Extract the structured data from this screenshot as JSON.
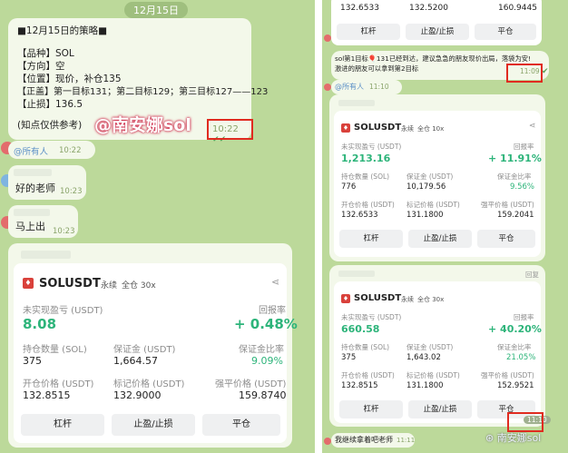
{
  "left": {
    "date_chip": "12月15日",
    "strategy": {
      "lines": [
        "■12月15日的策略■",
        "【品种】SOL",
        "【方向】空",
        "【位置】现价，补仓135",
        "【正盖】第一目标131；第二目标129；第三目标127——123",
        "【止损】136.5",
        "(知点仅供参考)"
      ],
      "time": "10:22"
    },
    "mention_all": "@所有人",
    "mention_time": "10:22",
    "msg1": {
      "text": "好的老师",
      "time": "10:23"
    },
    "msg2": {
      "text": "马上出",
      "time": "10:23"
    },
    "card": {
      "symbol": "SOLUSDT",
      "perp": "永续",
      "margin_mode": "全仓 30x",
      "pnl_label": "未实现盈亏 (USDT)",
      "roi_label": "回报率",
      "pnl": "8.08",
      "roi": "+ 0.48%",
      "row1": [
        "持仓数量 (SOL)",
        "保证金 (USDT)",
        "保证金比率"
      ],
      "row1_vals": [
        "375",
        "1,664.57",
        "9.09%"
      ],
      "row2": [
        "开仓价格 (USDT)",
        "标记价格 (USDT)",
        "强平价格 (USDT)"
      ],
      "row2_vals": [
        "132.8515",
        "132.9000",
        "159.8740"
      ],
      "buttons": [
        "杠杆",
        "止盈/止损",
        "平仓"
      ]
    },
    "watermark": "@南安娜sol"
  },
  "right": {
    "top_values": [
      "132.6533",
      "132.5200",
      "160.9445"
    ],
    "top_buttons": [
      "杠杆",
      "止盈/止损",
      "平仓"
    ],
    "msg": {
      "line1": "sol第1目标🎈131已经到达，建议急急的朋友现价出局，落袋为安!",
      "line2": "激进的朋友可以拿到第2目标",
      "time": "11:09"
    },
    "mention_all": "@所有人",
    "mention_time": "11:10",
    "card1": {
      "symbol": "SOLUSDT",
      "perp": "永续",
      "margin_mode": "全仓 10x",
      "pnl_label": "未实现盈亏 (USDT)",
      "roi_label": "回报率",
      "pnl": "1,213.16",
      "roi": "+ 11.91%",
      "row1": [
        "持仓数量 (SOL)",
        "保证金 (USDT)",
        "保证金比率"
      ],
      "row1_vals": [
        "776",
        "10,179.56",
        "9.56%"
      ],
      "row2": [
        "开仓价格 (USDT)",
        "标记价格 (USDT)",
        "强平价格 (USDT)"
      ],
      "row2_vals": [
        "132.6533",
        "131.1800",
        "159.2041"
      ],
      "buttons": [
        "杠杆",
        "止盈/止损",
        "平仓"
      ]
    },
    "card2": {
      "reply_label": "回复",
      "symbol": "SOLUSDT",
      "perp": "永续",
      "margin_mode": "全仓 30x",
      "pnl_label": "未实现盈亏 (USDT)",
      "roi_label": "回报率",
      "pnl": "660.58",
      "roi": "+ 40.20%",
      "row1": [
        "持仓数量 (SOL)",
        "保证金 (USDT)",
        "保证金比率"
      ],
      "row1_vals": [
        "375",
        "1,643.02",
        "21.05%"
      ],
      "row2": [
        "开仓价格 (USDT)",
        "标记价格 (USDT)",
        "强平价格 (USDT)"
      ],
      "row2_vals": [
        "132.8515",
        "131.1800",
        "152.9521"
      ],
      "buttons": [
        "杠杆",
        "止盈/止损",
        "平仓"
      ],
      "time": "11:10"
    },
    "bottom_msg": {
      "text": "我继续拿着吧老师",
      "time": "11:11"
    },
    "watermark": "南安娜sol"
  },
  "colors": {
    "chat_bg": "#bcd99a",
    "bubble": "#f3f8ea",
    "profit_green": "#2db47a",
    "highlight_red": "#e02b20"
  }
}
